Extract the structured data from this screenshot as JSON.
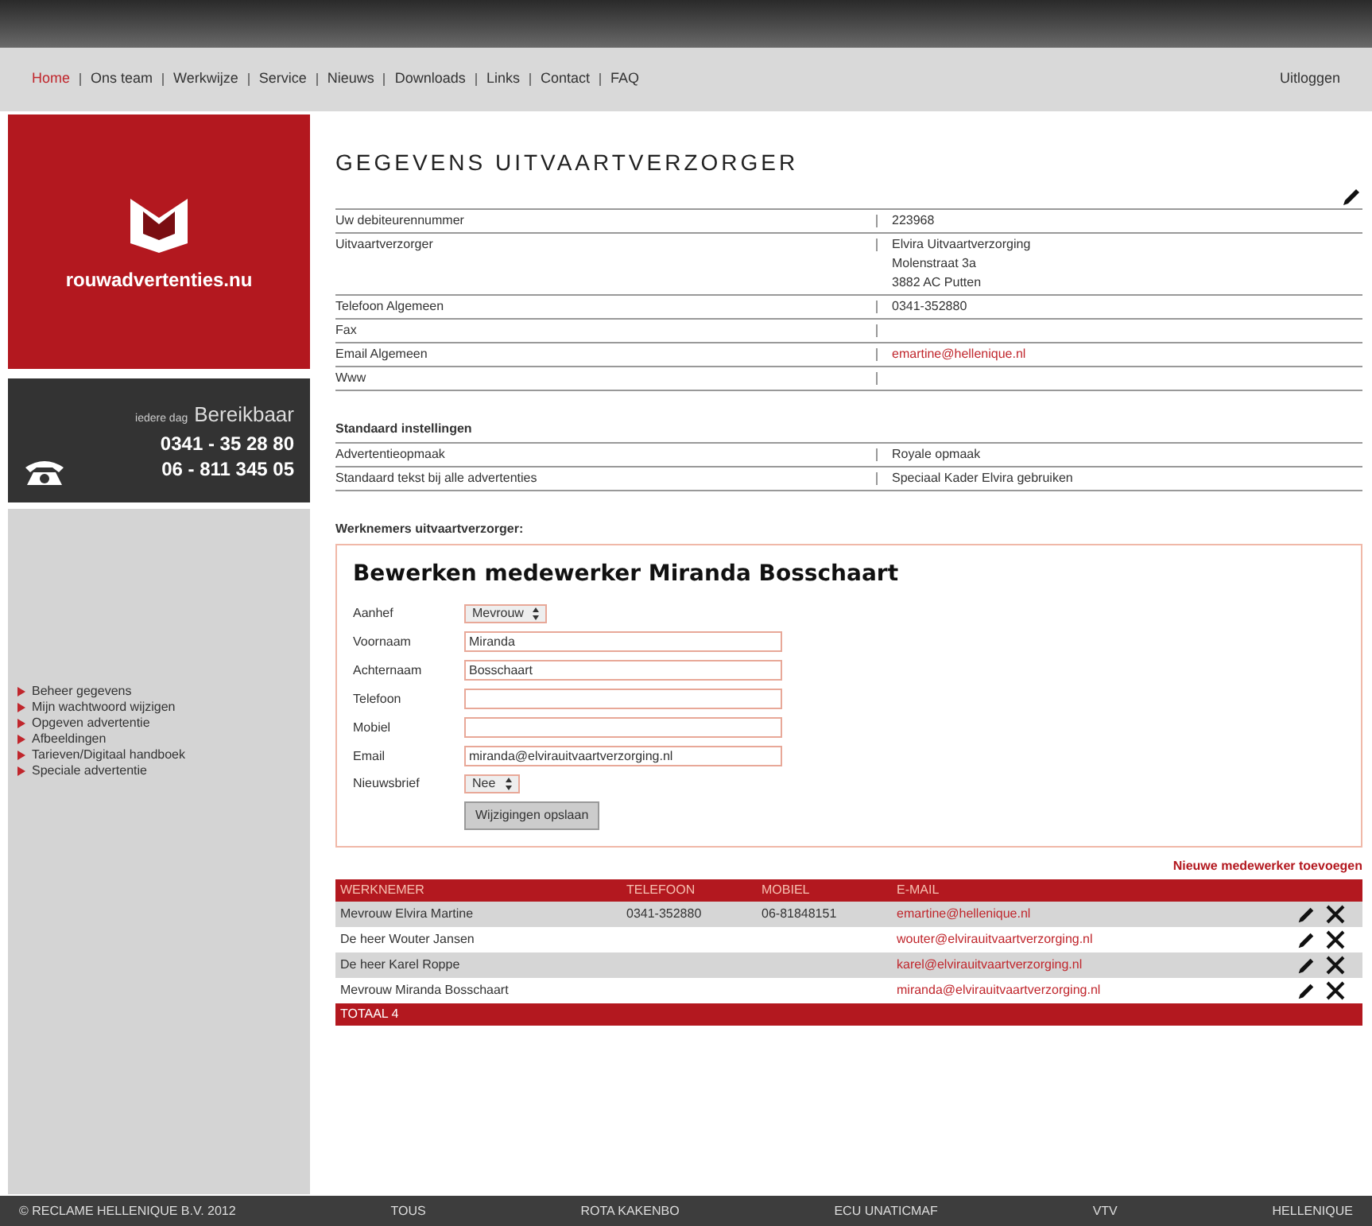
{
  "nav": {
    "items": [
      {
        "label": "Home",
        "selected": true
      },
      {
        "label": "Ons team",
        "selected": false
      },
      {
        "label": "Werkwijze",
        "selected": false
      },
      {
        "label": "Service",
        "selected": false
      },
      {
        "label": "Nieuws",
        "selected": false
      },
      {
        "label": "Downloads",
        "selected": false
      },
      {
        "label": "Links",
        "selected": false
      },
      {
        "label": "Contact",
        "selected": false
      },
      {
        "label": "FAQ",
        "selected": false
      }
    ],
    "logout": "Uitloggen"
  },
  "brand": {
    "name": "rouwadvertenties.nu"
  },
  "contact": {
    "tagline": "iedere dag",
    "title": "Bereikbaar",
    "phones": [
      "0341 - 35 28 80",
      "06 - 811 345 05"
    ]
  },
  "sidebar": {
    "items": [
      "Beheer gegevens",
      "Mijn wachtwoord wijzigen",
      "Opgeven advertentie",
      "Afbeeldingen",
      "Tarieven/Digitaal handboek",
      "Speciale advertentie"
    ]
  },
  "main": {
    "title": "GEGEVENS UITVAARTVERZORGER",
    "details": [
      {
        "label": "Uw debiteurennummer",
        "lines": [
          "223968"
        ],
        "kind": "text"
      },
      {
        "label": "Uitvaartverzorger",
        "lines": [
          "Elvira Uitvaartverzorging",
          "Molenstraat 3a",
          "3882 AC  Putten"
        ],
        "kind": "text"
      },
      {
        "label": "Telefoon Algemeen",
        "lines": [
          "0341-352880"
        ],
        "kind": "text"
      },
      {
        "label": "Fax"
      },
      {
        "label": "Email Algemeen",
        "lines": [
          "emartine@hellenique.nl"
        ],
        "kind": "link"
      },
      {
        "label": "Www"
      }
    ],
    "settings_title": "Standaard instellingen",
    "settings": [
      {
        "label": "Advertentieopmaak",
        "value": "Royale opmaak"
      },
      {
        "label": "Standaard tekst bij alle advertenties",
        "value": "Speciaal Kader Elvira gebruiken"
      }
    ],
    "employees_title": "Werknemers uitvaartverzorger:",
    "form": {
      "title": "Bewerken medewerker Miranda Bosschaart",
      "fields": [
        {
          "label": "Aanhef",
          "kind": "select",
          "value": "Mevrouw"
        },
        {
          "label": "Voornaam",
          "kind": "text",
          "value": "Miranda"
        },
        {
          "label": "Achternaam",
          "kind": "text",
          "value": "Bosschaart"
        },
        {
          "label": "Telefoon",
          "kind": "text"
        },
        {
          "label": "Mobiel",
          "kind": "text"
        },
        {
          "label": "Email",
          "kind": "text",
          "value": "miranda@elvirauitvaartverzorging.nl"
        },
        {
          "label": "Nieuwsbrief",
          "kind": "select",
          "value": "Nee"
        }
      ],
      "button": "Wijzigingen opslaan"
    },
    "add_link": "Nieuwe medewerker toevoegen",
    "table": {
      "columns": [
        "WERKNEMER",
        "TELEFOON",
        "MOBIEL",
        "E-MAIL"
      ],
      "rows": [
        {
          "cells": [
            "Mevrouw Elvira Martine",
            "0341-352880",
            "06-81848151",
            "emartine@hellenique.nl"
          ]
        },
        {
          "cells": [
            "De heer Wouter Jansen",
            "",
            "",
            "wouter@elvirauitvaartverzorging.nl"
          ]
        },
        {
          "cells": [
            "De heer Karel Roppe",
            "",
            "",
            "karel@elvirauitvaartverzorging.nl"
          ]
        },
        {
          "cells": [
            "Mevrouw Miranda Bosschaart",
            "",
            "",
            "miranda@elvirauitvaartverzorging.nl"
          ]
        }
      ],
      "total": "TOTAAL 4"
    }
  },
  "footer": {
    "items": [
      "© RECLAME HELLENIQUE B.V. 2012",
      "TOUS",
      "ROTA KAKENBO",
      "ECU UNATICMAF",
      "VTV",
      "HELLENIQUE"
    ]
  }
}
